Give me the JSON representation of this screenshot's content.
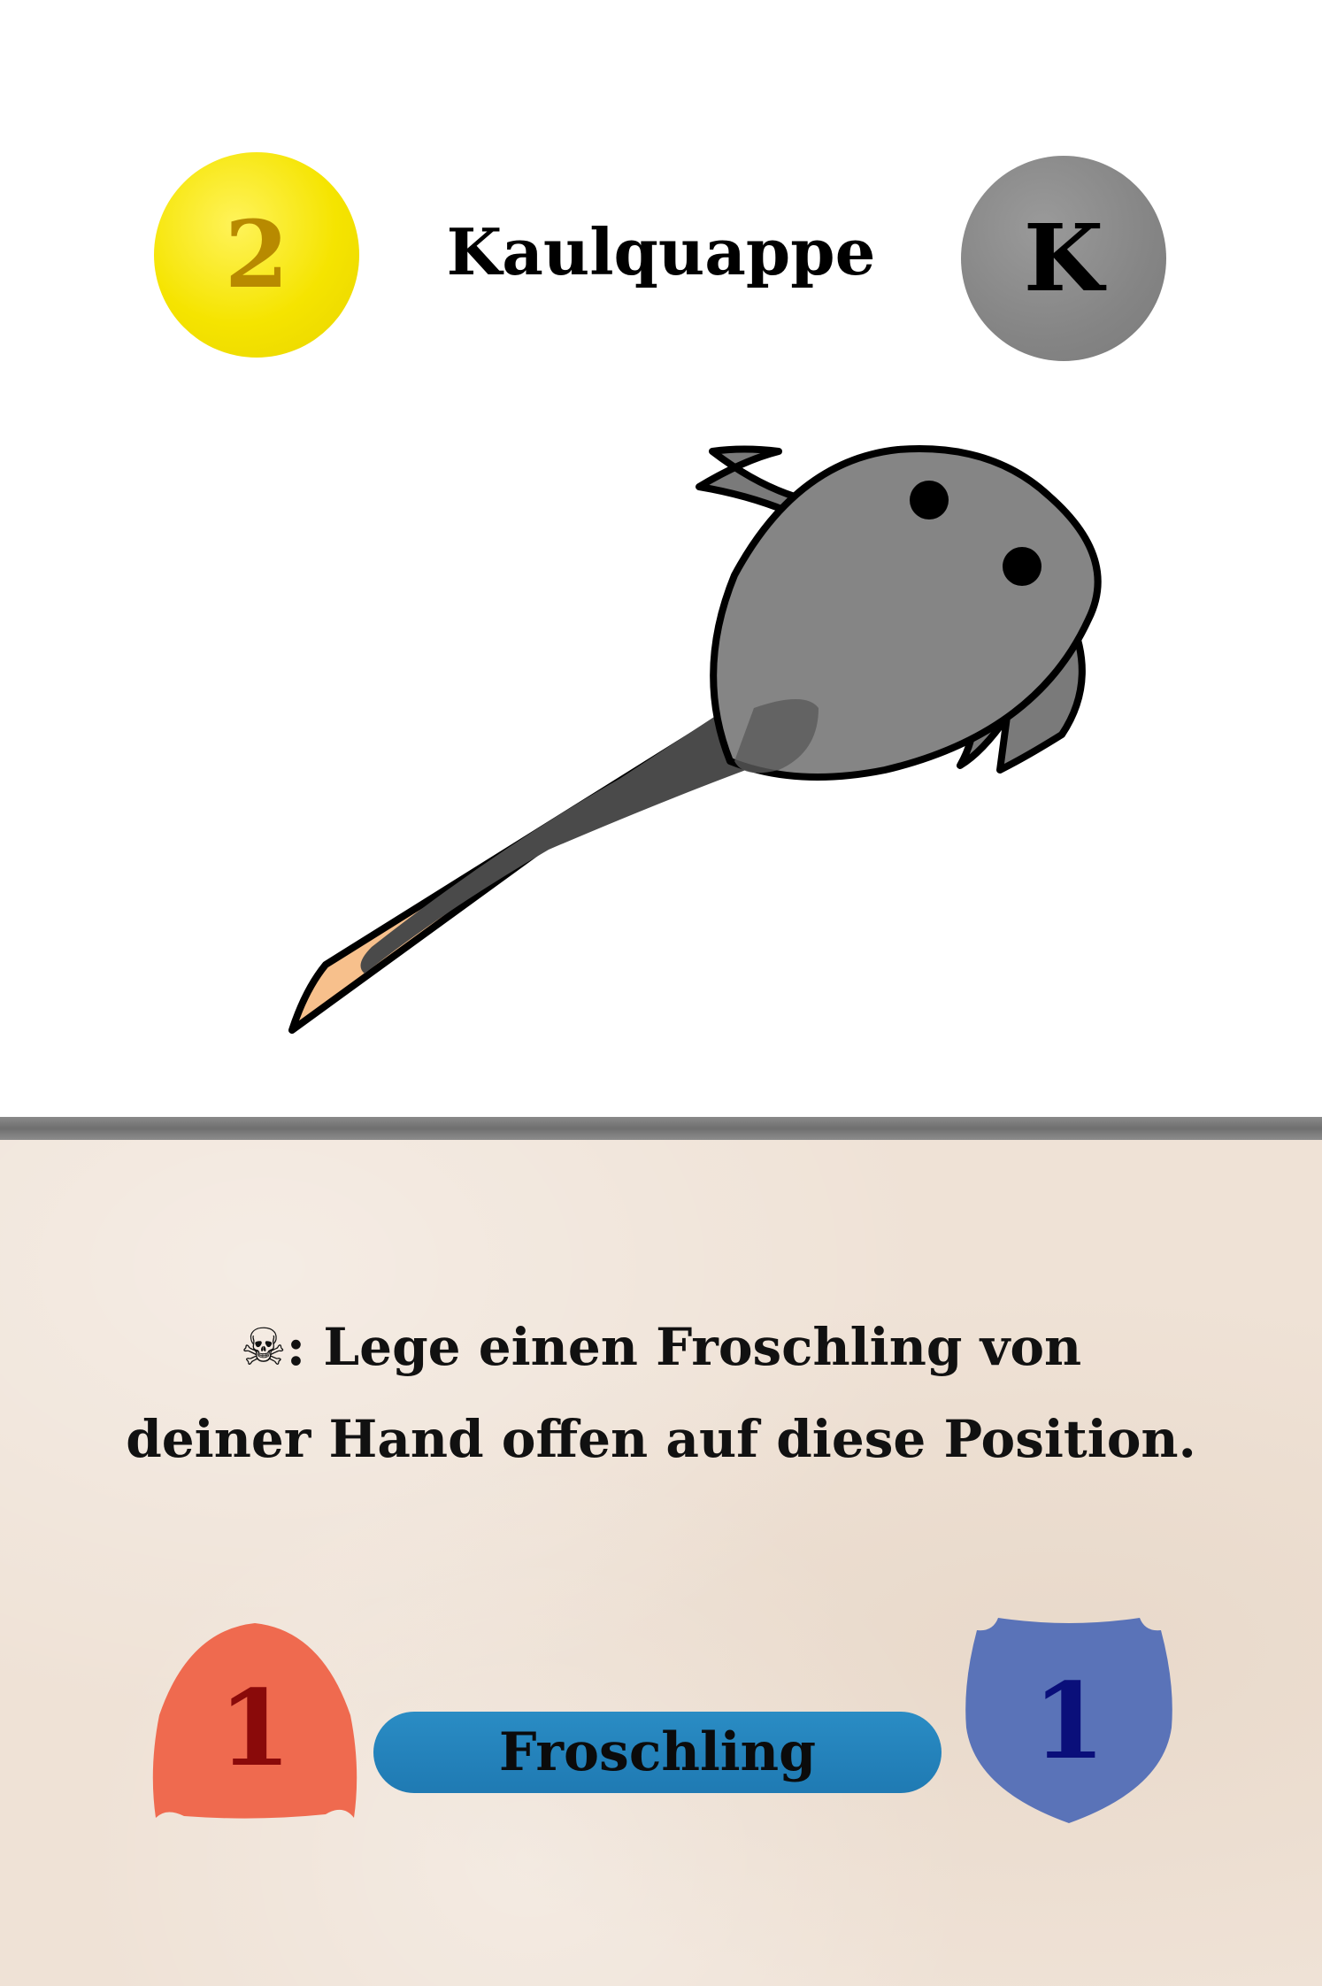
{
  "card": {
    "name": "Kaulquappe",
    "cost": "2",
    "type_letter": "K",
    "cost_color": "#f5e400",
    "type_color": "#858585",
    "illustration": "tadpole",
    "ability": {
      "icon": "skull-crossbones-icon",
      "icon_glyph": "☠",
      "line1": ": Lege einen Froschling von",
      "line2": "deiner Hand offen auf diese Position."
    },
    "attack": "1",
    "defense": "1",
    "tribe": "Froschling",
    "attack_color": "#ef6a4f",
    "defense_color": "#5a73b8",
    "tribe_color": "#2185bd"
  }
}
